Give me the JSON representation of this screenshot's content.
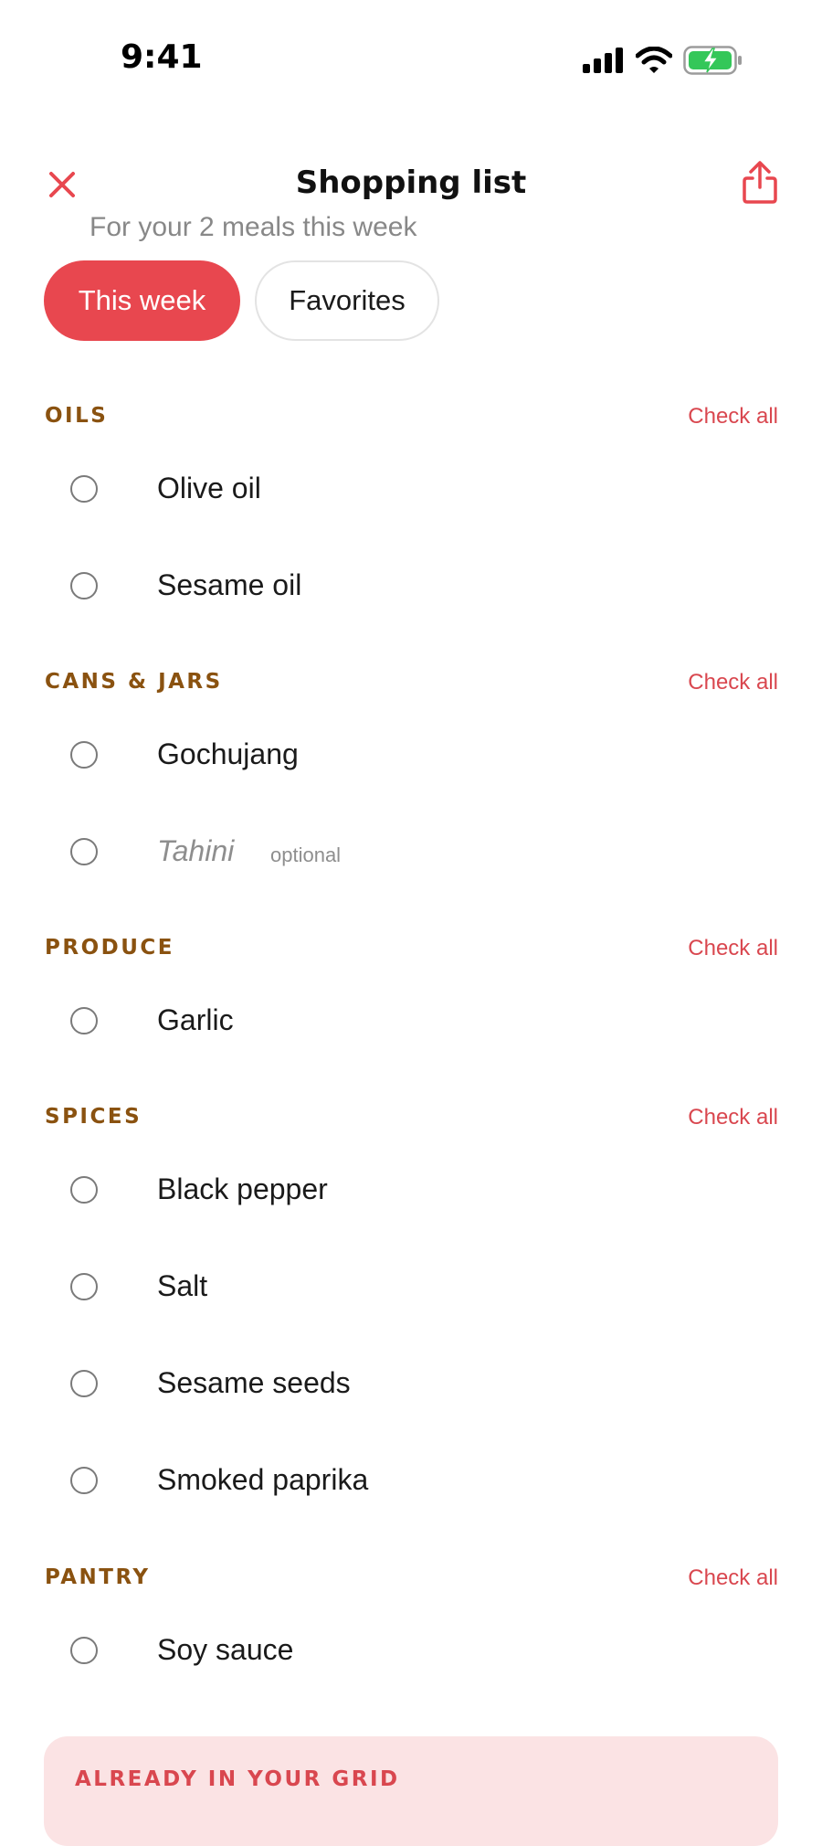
{
  "status_bar": {
    "time": "9:41",
    "icons": [
      "signal-icon",
      "wifi-icon",
      "battery-charging-icon"
    ]
  },
  "header": {
    "title": "Shopping list",
    "subtitle": "For your 2 meals this week",
    "close_icon": "close-icon",
    "share_icon": "share-icon"
  },
  "tabs": [
    {
      "label": "This week",
      "active": true
    },
    {
      "label": "Favorites",
      "active": false
    }
  ],
  "check_all_label": "Check all",
  "sections": [
    {
      "title": "OILS",
      "items": [
        {
          "label": "Olive oil"
        },
        {
          "label": "Sesame oil"
        }
      ]
    },
    {
      "title": "CANS & JARS",
      "items": [
        {
          "label": "Gochujang"
        },
        {
          "label": "Tahini",
          "tag": "optional"
        }
      ]
    },
    {
      "title": "PRODUCE",
      "items": [
        {
          "label": "Garlic"
        }
      ]
    },
    {
      "title": "SPICES",
      "items": [
        {
          "label": "Black pepper"
        },
        {
          "label": "Salt"
        },
        {
          "label": "Sesame seeds"
        },
        {
          "label": "Smoked paprika"
        }
      ]
    },
    {
      "title": "PANTRY",
      "items": [
        {
          "label": "Soy sauce"
        }
      ]
    }
  ],
  "grid_card": {
    "title": "ALREADY IN YOUR GRID"
  },
  "colors": {
    "accent": "#e8474f",
    "section_title": "#8a5210",
    "link": "#d9474f",
    "card_bg": "#fbe3e4",
    "battery": "#34c759"
  }
}
